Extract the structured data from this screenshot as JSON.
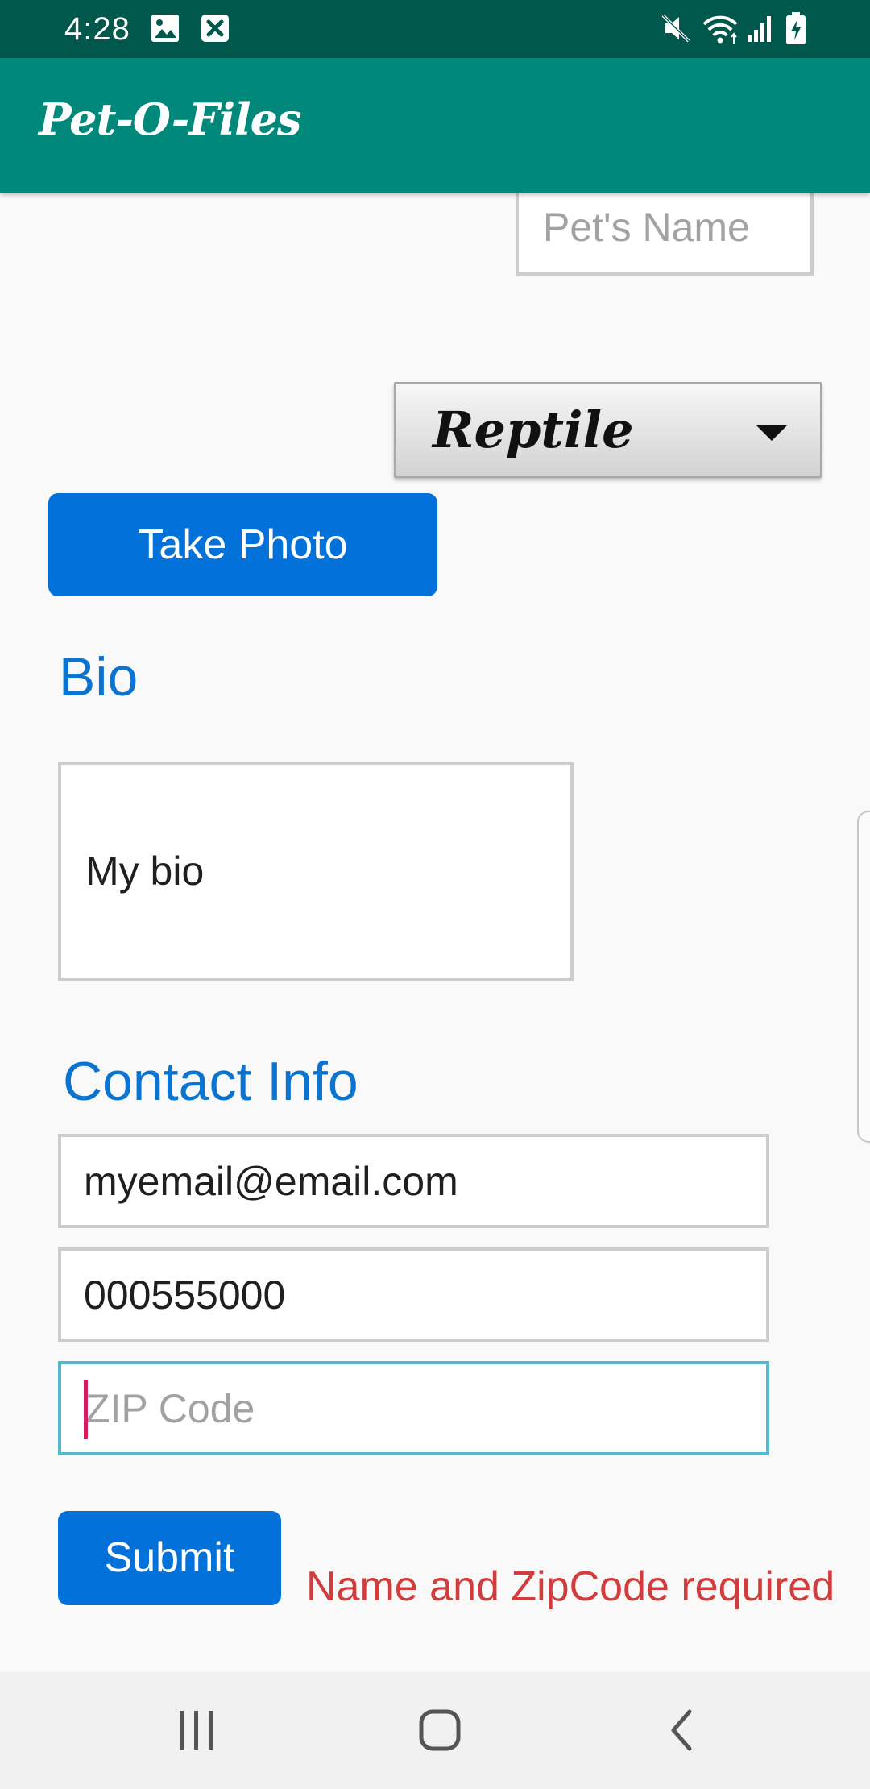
{
  "status_bar": {
    "time": "4:28",
    "background": "#00574b",
    "icons": [
      "gallery-icon",
      "close-box-icon",
      "mute-icon",
      "wifi-icon",
      "cellular-signal-icon",
      "battery-charging-icon"
    ]
  },
  "app_bar": {
    "title": "Pet-O-Files",
    "background": "#00887a"
  },
  "form": {
    "pet_name": {
      "value": "",
      "placeholder": "Pet's Name"
    },
    "type_dropdown": {
      "selected": "Reptile"
    },
    "take_photo_label": "Take Photo",
    "bio_heading": "Bio",
    "bio": {
      "value": "My bio"
    },
    "contact_heading": "Contact Info",
    "email": {
      "value": "myemail@email.com"
    },
    "phone": {
      "value": "000555000"
    },
    "zip": {
      "value": "",
      "placeholder": "ZIP Code",
      "focused": true
    },
    "submit_label": "Submit",
    "error_message": "Name and ZipCode required"
  },
  "nav_bar": {
    "icons": [
      "recent-apps-icon",
      "home-icon",
      "back-icon"
    ]
  },
  "colors": {
    "accent_button": "#0271d9",
    "heading_blue": "#0a74d0",
    "error_red": "#d23c3c",
    "focus_border": "#56b8d0",
    "cursor": "#d81b60"
  }
}
